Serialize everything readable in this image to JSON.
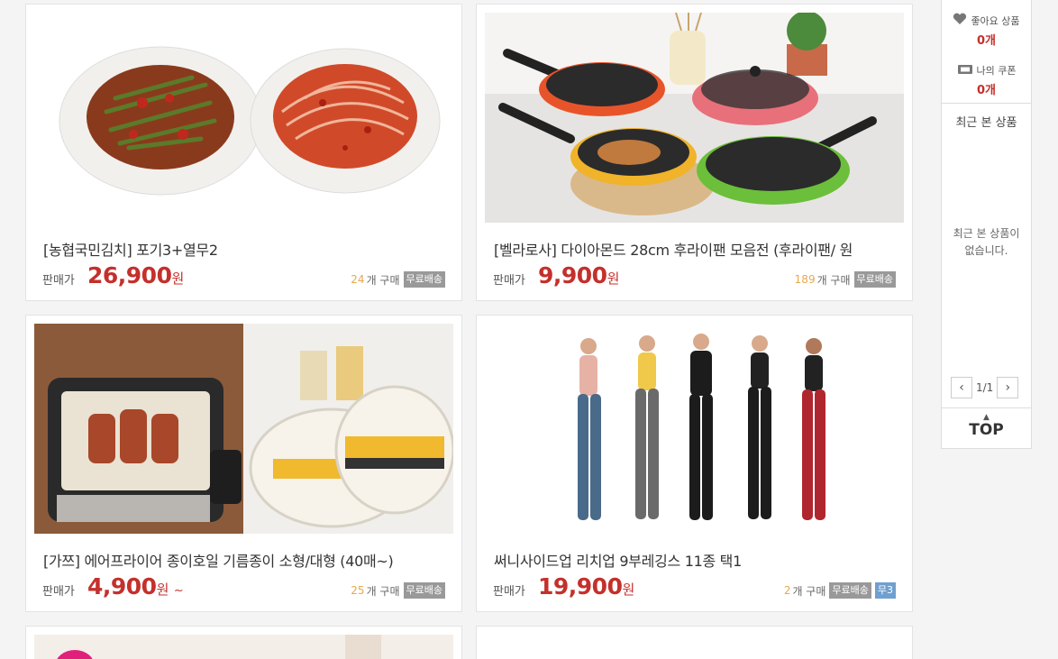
{
  "products": [
    {
      "title": "[농협국민김치] 포기3+열무2",
      "price_label": "판매가",
      "price": "26,900",
      "currency": "원",
      "suffix": "",
      "buy_count": "24",
      "buy_text": "개 구매",
      "badges": [
        "무료배송"
      ]
    },
    {
      "title": "[벨라로사] 다이아몬드 28cm 후라이팬 모음전 (후라이팬/ 원",
      "price_label": "판매가",
      "price": "9,900",
      "currency": "원",
      "suffix": "",
      "buy_count": "189",
      "buy_text": "개 구매",
      "badges": [
        "무료배송"
      ]
    },
    {
      "title": "[가쯔] 에어프라이어 종이호일 기름종이 소형/대형 (40매~)",
      "price_label": "판매가",
      "price": "4,900",
      "currency": "원",
      "suffix": "~",
      "buy_count": "25",
      "buy_text": "개 구매",
      "badges": [
        "무료배송"
      ]
    },
    {
      "title": "써니사이드업 리치업 9부레깅스 11종 택1",
      "price_label": "판매가",
      "price": "19,900",
      "currency": "원",
      "suffix": "",
      "buy_count": "2",
      "buy_text": "개 구매",
      "badges": [
        "무료배송",
        "무3"
      ]
    }
  ],
  "sidebar": {
    "likes_label": "좋아요 상품",
    "likes_count": "0개",
    "coupon_label": "나의 쿠폰",
    "coupon_count": "0개",
    "recent_title": "최근 본 상품",
    "recent_empty": "최근 본 상품이 없습니다.",
    "pager": "1/1",
    "top_label": "TOP"
  },
  "colors": {
    "price": "#c4302b",
    "count": "#e8a84d",
    "badge": "#999999",
    "badge_blue": "#6fa0d0"
  },
  "icons": [
    "heart-icon",
    "ticket-icon",
    "chevron-left-icon",
    "chevron-right-icon",
    "caret-up-icon"
  ]
}
